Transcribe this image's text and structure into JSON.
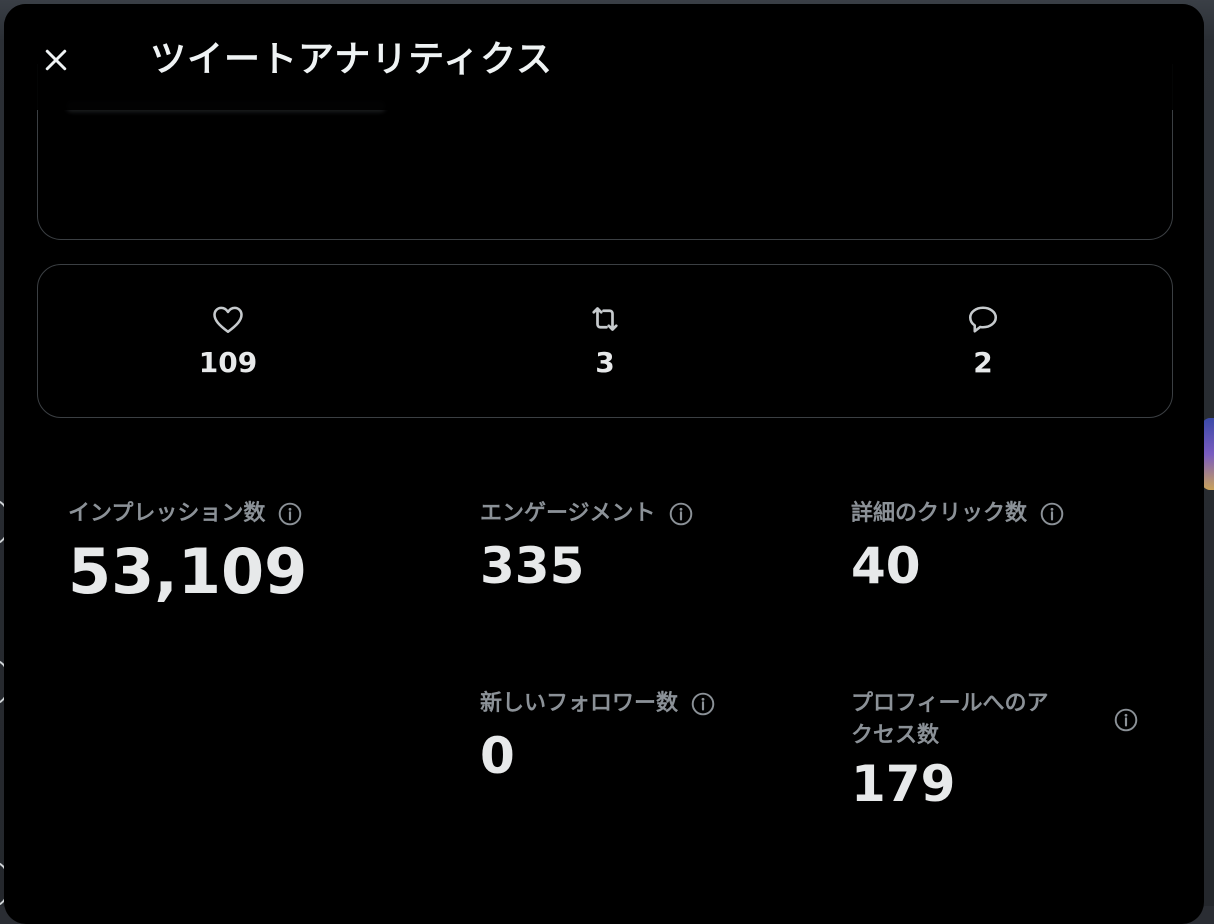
{
  "title": "ツイートアナリティクス",
  "engagement": {
    "likes": "109",
    "retweets": "3",
    "replies": "2"
  },
  "metrics": {
    "impressions": {
      "label": "インプレッション数",
      "value": "53,109"
    },
    "engagements": {
      "label": "エンゲージメント",
      "value": "335"
    },
    "detail_clicks": {
      "label": "詳細のクリック数",
      "value": "40"
    },
    "new_followers": {
      "label": "新しいフォロワー数",
      "value": "0"
    },
    "profile_visits": {
      "label_line1": "プロフィールへのア",
      "label_line2": "クセス数",
      "value": "179"
    }
  },
  "icons": {
    "close": "close-icon",
    "like": "heart-icon",
    "retweet": "retweet-icon",
    "reply": "reply-icon",
    "info": "info-icon"
  },
  "colors": {
    "background": "#000000",
    "text": "#e7e9ea",
    "muted": "#8b9197",
    "border": "#3b3f43"
  }
}
